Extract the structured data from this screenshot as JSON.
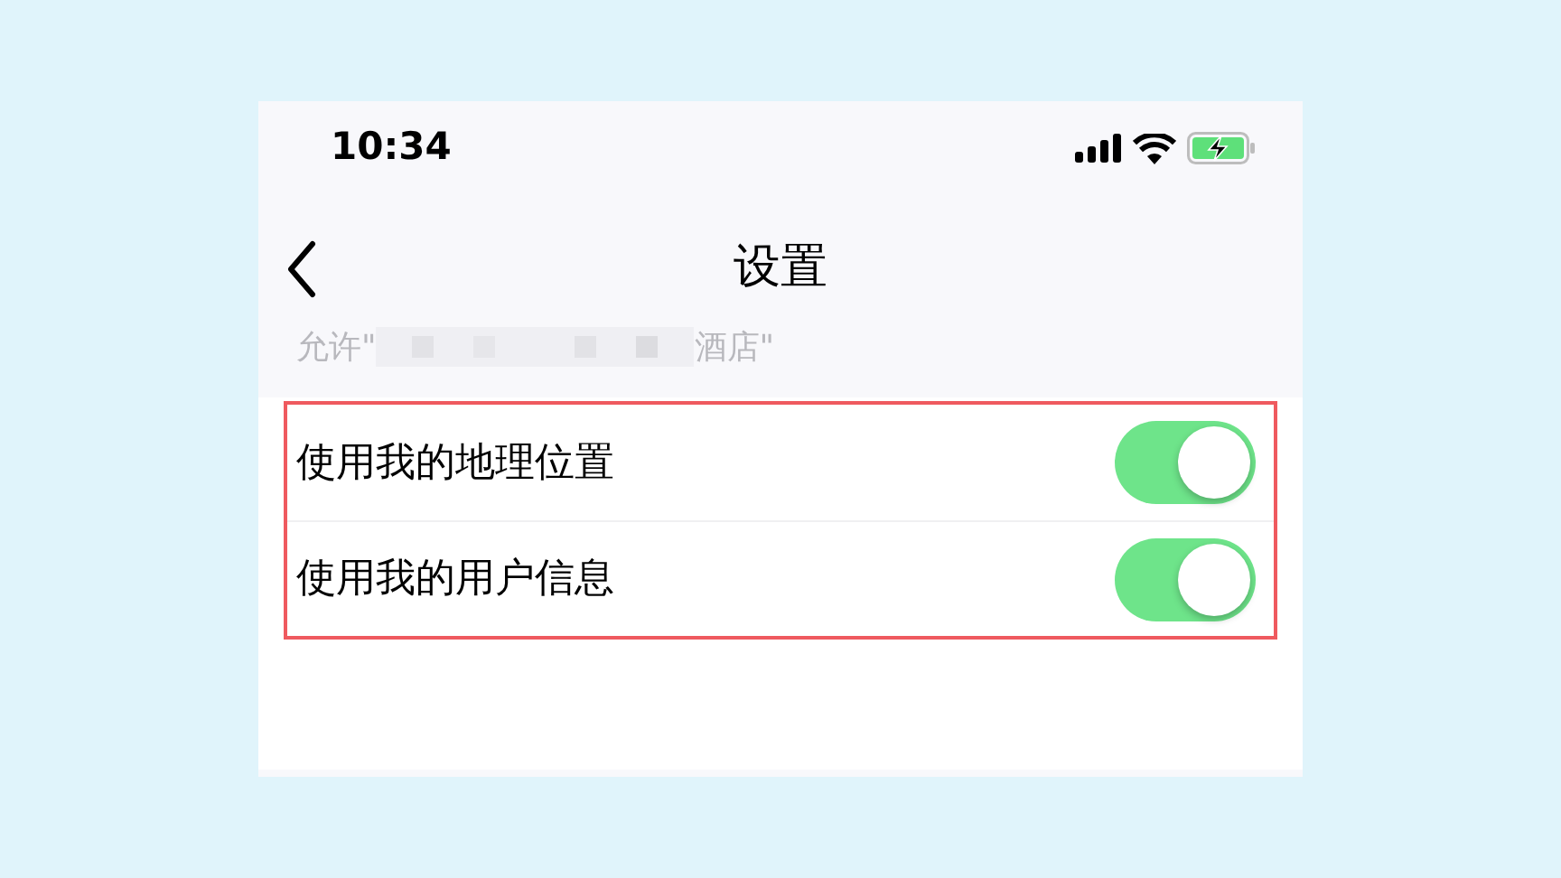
{
  "status_bar": {
    "time": "10:34"
  },
  "nav": {
    "title": "设置"
  },
  "subtitle": {
    "prefix": "允许\"",
    "suffix": "酒店\"",
    "redacted": true
  },
  "settings": [
    {
      "label": "使用我的地理位置",
      "on": true
    },
    {
      "label": "使用我的用户信息",
      "on": true
    }
  ],
  "highlight": true
}
